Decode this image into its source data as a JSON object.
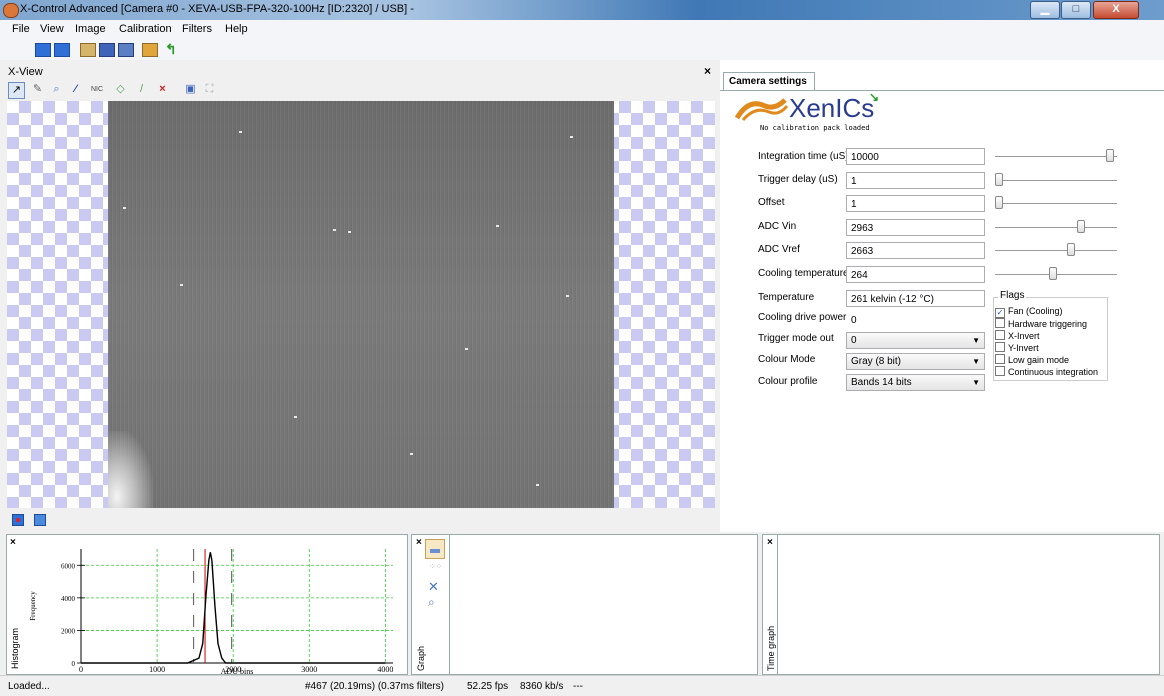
{
  "window": {
    "title": "X-Control Advanced [Camera #0 - XEVA-USB-FPA-320-100Hz [ID:2320] / USB] -",
    "minimize_symbol": "▁",
    "maximize_symbol": "□",
    "close_symbol": "X"
  },
  "menu": [
    "File",
    "View",
    "Image",
    "Calibration",
    "Filters",
    "Help"
  ],
  "xview": {
    "title": "X-View",
    "close_symbol": "×",
    "tools": [
      "↗",
      "✎",
      "⌕",
      "⁄",
      "NIC",
      "◇",
      "/",
      "×",
      "▣",
      "⛶"
    ]
  },
  "camera_settings": {
    "tab_label": "Camera settings",
    "logo_text": "XenICs",
    "calibration_message": "No calibration pack loaded",
    "fields": [
      {
        "label": "Integration time (uS)",
        "value": "10000",
        "slider": 0.97
      },
      {
        "label": "Trigger delay (uS)",
        "value": "1",
        "slider": 0.0
      },
      {
        "label": "Offset",
        "value": "1",
        "slider": 0.0
      },
      {
        "label": "ADC Vin",
        "value": "2963",
        "slider": 0.72
      },
      {
        "label": "ADC Vref",
        "value": "2663",
        "slider": 0.63
      },
      {
        "label": "Cooling temperature",
        "value": "264",
        "slider": 0.47
      },
      {
        "label": "Temperature",
        "value": "261 kelvin (-12 °C)"
      },
      {
        "label": "Cooling drive power",
        "value": "0"
      }
    ],
    "selects": [
      {
        "label": "Trigger mode out",
        "value": "0"
      },
      {
        "label": "Colour Mode",
        "value": "Gray (8 bit)"
      },
      {
        "label": "Colour profile",
        "value": "Bands 14 bits"
      }
    ],
    "flags_title": "Flags",
    "flags": [
      {
        "label": "Fan (Cooling)",
        "checked": true
      },
      {
        "label": "Hardware triggering",
        "checked": false
      },
      {
        "label": "X-Invert",
        "checked": false
      },
      {
        "label": "Y-Invert",
        "checked": false
      },
      {
        "label": "Low gain mode",
        "checked": false
      },
      {
        "label": "Continuous integration",
        "checked": false
      }
    ]
  },
  "histogram": {
    "panel_label": "Histogram",
    "ylabel": "Frequency",
    "xlabel": "ADU bins",
    "close_symbol": "×"
  },
  "graph_panel": {
    "label": "Graph",
    "close_symbol": "×"
  },
  "time_graph_panel": {
    "label": "Time graph",
    "close_symbol": "×"
  },
  "status": {
    "left": "Loaded...",
    "frame": "#467 (20.19ms) (0.37ms filters)",
    "fps": "52.25 fps",
    "rate": "8360 kb/s",
    "extra": "---"
  },
  "chart_data": {
    "type": "line",
    "xlabel": "ADU bins",
    "ylabel": "Frequency",
    "xlim": [
      0,
      4100
    ],
    "ylim": [
      0,
      7000
    ],
    "xticks": [
      0,
      1000,
      2000,
      3000,
      4000
    ],
    "yticks": [
      0,
      2000,
      4000,
      6000
    ],
    "grid": true,
    "series": [
      {
        "name": "",
        "color": "#000000",
        "x": [
          0,
          1400,
          1550,
          1600,
          1640,
          1680,
          1700,
          1720,
          1760,
          1800,
          1850,
          1900,
          2000,
          4000
        ],
        "values": [
          0,
          0,
          300,
          1200,
          4000,
          6300,
          6800,
          6300,
          3500,
          1200,
          300,
          0,
          0,
          0
        ]
      }
    ],
    "markers": [
      {
        "x": 1630,
        "color": "#cc0000"
      },
      {
        "x": 1480,
        "color": "#555555"
      },
      {
        "x": 1980,
        "color": "#555555"
      }
    ]
  }
}
